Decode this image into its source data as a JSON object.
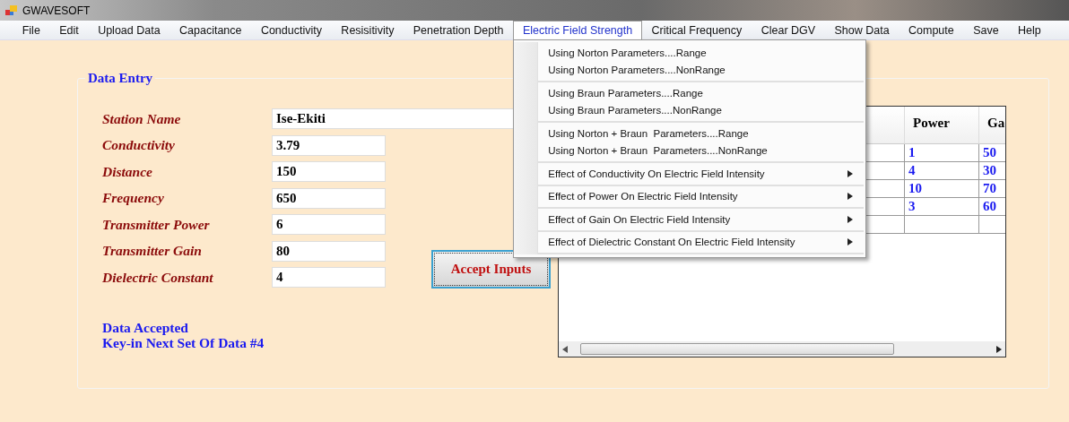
{
  "window": {
    "title": "GWAVESOFT"
  },
  "menu_bar": [
    {
      "label": "File",
      "selected": false
    },
    {
      "label": "Edit",
      "selected": false
    },
    {
      "label": "Upload Data",
      "selected": false
    },
    {
      "label": "Capacitance",
      "selected": false
    },
    {
      "label": "Conductivity",
      "selected": false
    },
    {
      "label": "Resisitivity",
      "selected": false
    },
    {
      "label": "Penetration Depth",
      "selected": false
    },
    {
      "label": "Electric Field Strength",
      "selected": true
    },
    {
      "label": "Critical Frequency",
      "selected": false
    },
    {
      "label": "Clear DGV",
      "selected": false
    },
    {
      "label": "Show Data",
      "selected": false
    },
    {
      "label": "Compute",
      "selected": false
    },
    {
      "label": "Save",
      "selected": false
    },
    {
      "label": "Help",
      "selected": false
    }
  ],
  "dropdown": {
    "groups": [
      [
        {
          "label": "Using Norton Parameters....Range",
          "submenu": false
        },
        {
          "label": "Using Norton Parameters....NonRange",
          "submenu": false
        }
      ],
      [
        {
          "label": "Using Braun Parameters....Range",
          "submenu": false
        },
        {
          "label": "Using Braun Parameters....NonRange",
          "submenu": false
        }
      ],
      [
        {
          "label": "Using Norton + Braun  Parameters....Range",
          "submenu": false
        },
        {
          "label": "Using Norton + Braun  Parameters....NonRange",
          "submenu": false
        }
      ],
      [
        {
          "label": "Effect of Conductivity On Electric Field Intensity",
          "submenu": true
        }
      ],
      [
        {
          "label": "Effect of Power On Electric Field Intensity",
          "submenu": true
        }
      ],
      [
        {
          "label": "Effect of Gain On Electric Field Intensity",
          "submenu": true
        }
      ],
      [
        {
          "label": "Effect of Dielectric Constant On Electric Field Intensity",
          "submenu": true
        }
      ]
    ]
  },
  "data_entry": {
    "title": "Data Entry",
    "fields": [
      {
        "label": "Station Name",
        "value": "Ise-Ekiti",
        "wide": true
      },
      {
        "label": "Conductivity",
        "value": "3.79",
        "wide": false
      },
      {
        "label": "Distance",
        "value": "150",
        "wide": false
      },
      {
        "label": "Frequency",
        "value": "650",
        "wide": false
      },
      {
        "label": "Transmitter Power",
        "value": "6",
        "wide": false
      },
      {
        "label": "Transmitter Gain",
        "value": "80",
        "wide": false
      },
      {
        "label": "Dielectric Constant",
        "value": "4",
        "wide": false
      }
    ],
    "button": "Accept Inputs",
    "status": [
      "Data Accepted",
      "Key-in Next Set Of Data #4"
    ]
  },
  "table": {
    "columns": [
      "Power",
      "Ga"
    ],
    "rows": [
      [
        "1",
        "50"
      ],
      [
        "4",
        "30"
      ],
      [
        "10",
        "70"
      ],
      [
        "3",
        "60"
      ]
    ]
  }
}
